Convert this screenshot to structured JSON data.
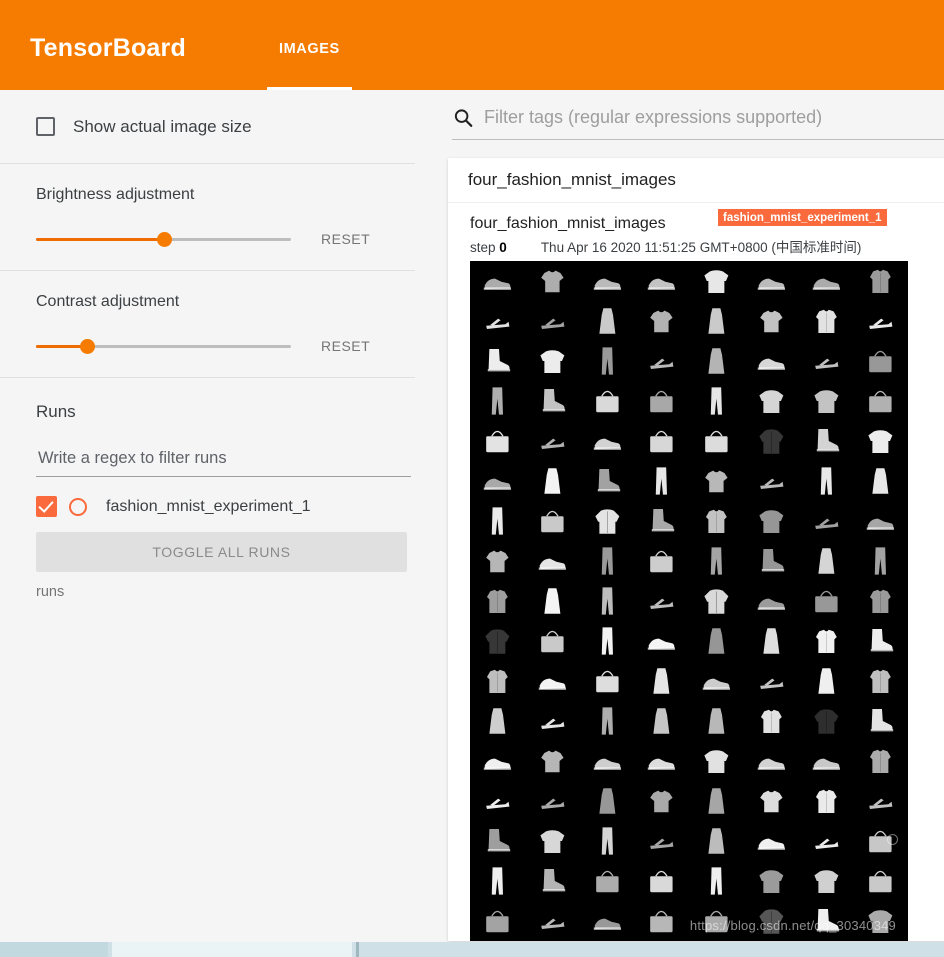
{
  "header": {
    "brand": "TensorBoard",
    "tabs": [
      {
        "label": "IMAGES",
        "active": true
      }
    ],
    "background_color": "#f57c00"
  },
  "sidebar": {
    "show_actual_image_size": {
      "label": "Show actual image size",
      "checked": false
    },
    "brightness": {
      "title": "Brightness adjustment",
      "reset_label": "RESET",
      "value_percent": 50
    },
    "contrast": {
      "title": "Contrast adjustment",
      "reset_label": "RESET",
      "value_percent": 20
    },
    "runs": {
      "title": "Runs",
      "filter_placeholder": "Write a regex to filter runs",
      "filter_value": "",
      "items": [
        {
          "label": "fashion_mnist_experiment_1",
          "checked": true,
          "color": "#fa6a3c"
        }
      ],
      "toggle_all_label": "TOGGLE ALL RUNS",
      "footnote": "runs"
    }
  },
  "main": {
    "search": {
      "placeholder": "Filter tags (regular expressions supported)",
      "value": "",
      "icon": "search-icon"
    },
    "tag_group": {
      "title": "four_fashion_mnist_images"
    },
    "image_card": {
      "title": "four_fashion_mnist_images",
      "run_badge": "fashion_mnist_experiment_1",
      "step_prefix": "step",
      "step_value": "0",
      "timestamp": "Thu Apr 16 2020 11:51:25 GMT+0800 (中国标准时间)",
      "watermark": "https://blog.csdn.net/qq_30340349"
    }
  },
  "colors": {
    "accent": "#f57c00",
    "run_color": "#fa6a3c",
    "panel_bg": "#f5f5f5",
    "card_bg": "#ffffff",
    "image_bg": "#000000"
  },
  "chart_data": {
    "type": "heatmap",
    "title": "four_fashion_mnist_images",
    "description": "Fashion-MNIST sample sprite: grayscale 28x28 garment thumbnails tiled in a grid",
    "grid_columns": 8,
    "grid_rows": 17,
    "background": "#000000",
    "items": [
      "sneaker",
      "tshirt",
      "sneaker",
      "sneaker",
      "pullover",
      "sneaker",
      "sneaker",
      "shirt",
      "sandal",
      "sandal",
      "dress",
      "tshirt",
      "dress",
      "tshirt",
      "shirt",
      "sandal",
      "ankle-boot",
      "pullover",
      "trouser",
      "sandal",
      "dress",
      "sneaker",
      "sandal",
      "bag",
      "trouser",
      "ankle-boot",
      "bag",
      "bag",
      "trouser",
      "pullover",
      "pullover",
      "bag",
      "bag",
      "sandal",
      "sneaker",
      "bag",
      "bag",
      "coat",
      "ankle-boot",
      "pullover",
      "sneaker",
      "dress",
      "ankle-boot",
      "trouser",
      "tshirt",
      "sandal",
      "trouser",
      "dress",
      "trouser",
      "bag",
      "coat",
      "ankle-boot",
      "shirt",
      "pullover",
      "sandal",
      "sneaker",
      "tshirt",
      "sneaker",
      "trouser",
      "bag",
      "trouser",
      "ankle-boot",
      "dress",
      "trouser",
      "shirt",
      "dress",
      "trouser",
      "sandal",
      "coat",
      "sneaker",
      "bag",
      "shirt",
      "coat",
      "bag",
      "trouser",
      "sneaker",
      "dress",
      "dress",
      "shirt",
      "ankle-boot",
      "shirt",
      "sneaker",
      "bag",
      "dress",
      "sneaker",
      "sandal",
      "dress",
      "shirt",
      "dress",
      "sandal",
      "trouser",
      "dress",
      "dress",
      "shirt",
      "coat",
      "ankle-boot"
    ]
  }
}
